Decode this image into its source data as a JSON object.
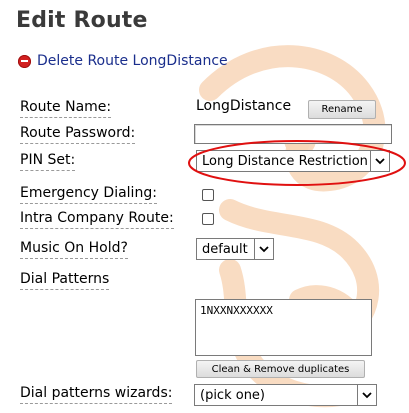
{
  "page": {
    "title": "Edit Route",
    "delete_link": "Delete Route LongDistance"
  },
  "form": {
    "route_name": {
      "label": "Route Name:",
      "value": "LongDistance",
      "button": "Rename"
    },
    "route_password": {
      "label": "Route Password:",
      "value": ""
    },
    "pin_set": {
      "label": "PIN Set:",
      "selected": "Long Distance Restriction"
    },
    "emergency_dialing": {
      "label": "Emergency Dialing:",
      "checked": false
    },
    "intra_company_route": {
      "label": "Intra Company Route:",
      "checked": false
    },
    "music_on_hold": {
      "label": "Music On Hold?",
      "selected": "default"
    },
    "dial_patterns": {
      "label": "Dial Patterns",
      "value": "1NXXNXXXXXX",
      "button": "Clean & Remove duplicates"
    },
    "dial_patterns_wizards": {
      "label": "Dial patterns wizards:",
      "selected": "(pick one)"
    }
  },
  "annotation": {
    "color": "#e01010"
  },
  "colors": {
    "link": "#1a2e8c",
    "watermark": "#f6c9a0",
    "title": "#3a3a3a"
  }
}
